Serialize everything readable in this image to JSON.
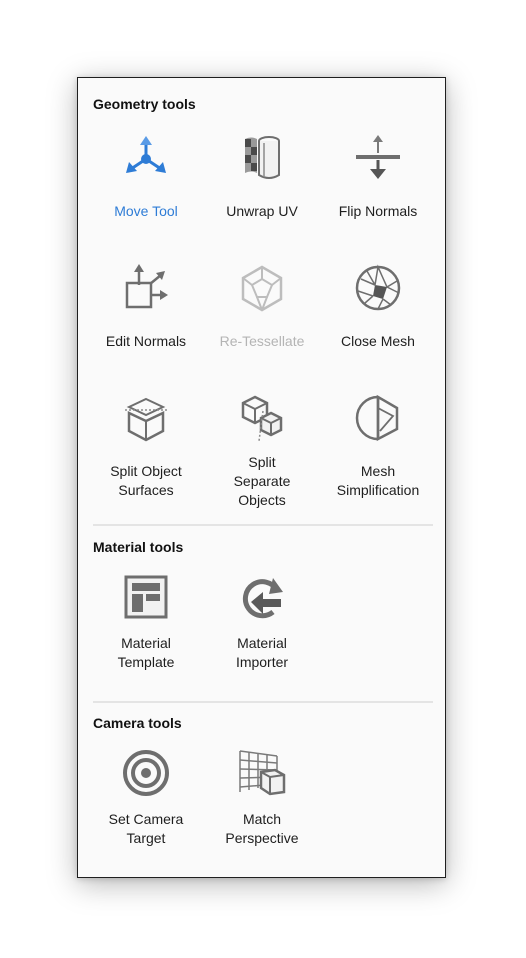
{
  "sections": {
    "geometry": {
      "title": "Geometry tools",
      "tools": [
        {
          "label": "Move Tool",
          "icon": "move-gizmo-icon",
          "state": "active"
        },
        {
          "label": "Unwrap UV",
          "icon": "unwrap-uv-icon",
          "state": "normal"
        },
        {
          "label": "Flip Normals",
          "icon": "flip-normals-icon",
          "state": "normal"
        },
        {
          "label": "Edit Normals",
          "icon": "edit-normals-icon",
          "state": "normal"
        },
        {
          "label": "Re-Tessellate",
          "icon": "retessellate-icon",
          "state": "disabled"
        },
        {
          "label": "Close Mesh",
          "icon": "close-mesh-icon",
          "state": "normal"
        },
        {
          "label": "Split Object\nSurfaces",
          "icon": "split-surfaces-icon",
          "state": "normal"
        },
        {
          "label": "Split\nSeparate\nObjects",
          "icon": "split-objects-icon",
          "state": "normal"
        },
        {
          "label": "Mesh\nSimplification",
          "icon": "mesh-simplification-icon",
          "state": "normal"
        }
      ]
    },
    "material": {
      "title": "Material tools",
      "tools": [
        {
          "label": "Material\nTemplate",
          "icon": "material-template-icon",
          "state": "normal"
        },
        {
          "label": "Material\nImporter",
          "icon": "material-importer-icon",
          "state": "normal"
        }
      ]
    },
    "camera": {
      "title": "Camera tools",
      "tools": [
        {
          "label": "Set Camera\nTarget",
          "icon": "camera-target-icon",
          "state": "normal"
        },
        {
          "label": "Match\nPerspective",
          "icon": "match-perspective-icon",
          "state": "normal"
        }
      ]
    }
  },
  "colors": {
    "active": "#2e7cd6",
    "icon": "#6e6e6e",
    "disabled": "#bdbdbd",
    "text": "#1e1e1e"
  }
}
